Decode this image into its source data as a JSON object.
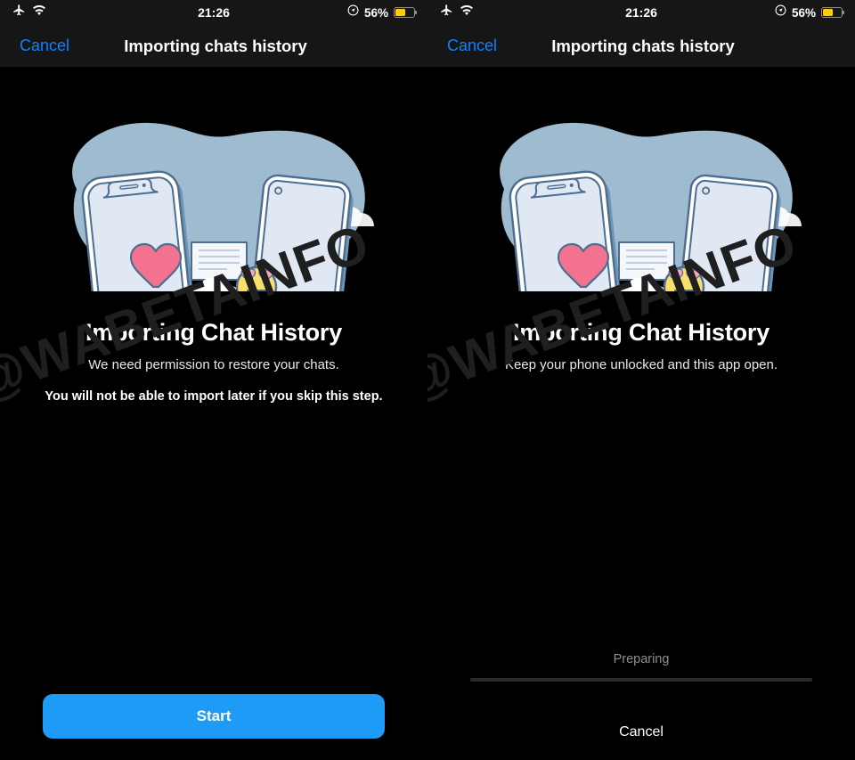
{
  "status_bar": {
    "airplane_icon": "airplane-mode-icon",
    "wifi_icon": "wifi-icon",
    "time": "21:26",
    "location_icon": "location-services-icon",
    "battery_percent": "56%",
    "battery_level": 56,
    "battery_color": "#ffcc00"
  },
  "nav_bar": {
    "cancel_label": "Cancel",
    "title": "Importing chats history",
    "accent_color": "#0a84ff"
  },
  "illustration": {
    "name": "two-phones-chat-transfer-illustration",
    "blob_color": "#9ebbd0",
    "phone_body_color": "#dfe8f3",
    "phone_outline_color": "#4e6e91",
    "phone_shadow_color": "#6f94b4",
    "bubble_green_color": "#5eab84",
    "heart_color": "#f2728f",
    "emoji_color": "#f6e06b",
    "cloud_color": "#ffffff"
  },
  "screens": [
    {
      "id": "permission-screen",
      "headline": "Importing Chat History",
      "subtitle": "We need permission to restore your chats.",
      "warning": "You will not be able to import later if you skip this step.",
      "primary_button": "Start",
      "primary_button_color": "#1d9bf6"
    },
    {
      "id": "progress-screen",
      "headline": "Importing Chat History",
      "subtitle": "Keep your phone unlocked and this app open.",
      "progress_label": "Preparing",
      "progress_percent": 0,
      "cancel_label": "Cancel"
    }
  ],
  "watermark": {
    "text": "@WABETAINFO",
    "color": "#1f1f1f"
  }
}
